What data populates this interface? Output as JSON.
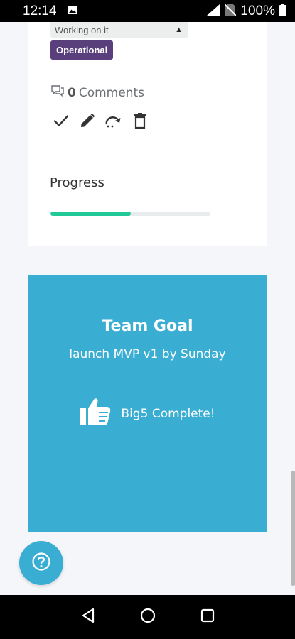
{
  "status_bar": {
    "time": "12:14",
    "battery": "100%"
  },
  "task_card": {
    "status_select": "Working on it",
    "tag": "Operational",
    "comments_count": "0",
    "comments_label": "Comments",
    "progress_label": "Progress",
    "progress_fraction": 0.5
  },
  "goal_card": {
    "title": "Team Goal",
    "description": "launch MVP v1 by Sunday",
    "status": "Big5 Complete!"
  },
  "colors": {
    "accent": "#3aaed2",
    "tag": "#5a3f7d",
    "progress": "#20c997"
  }
}
